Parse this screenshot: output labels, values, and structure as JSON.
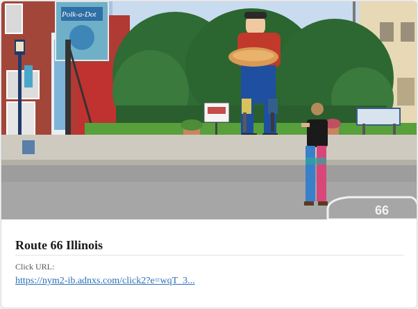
{
  "card": {
    "title": "Route 66 Illinois",
    "click_label": "Click URL:",
    "click_url": "https://nym2-ib.adnxs.com/click2?e=wqT_3..."
  },
  "photo": {
    "sign_text": "Polk-a-Dot",
    "road_shield_number": "66",
    "colors": {
      "sky": "#9fbde0",
      "trees": "#2f6b34",
      "shirt": "#c0392b",
      "pants": "#1f4fa0",
      "asphalt": "#9a9a9a"
    }
  }
}
